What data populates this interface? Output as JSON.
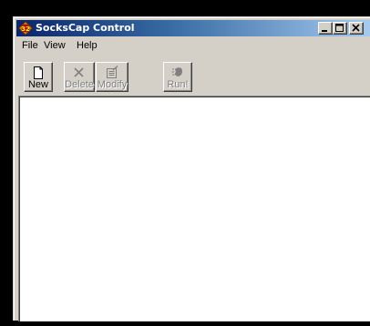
{
  "window": {
    "title": "SocksCap Control",
    "accent_color": "#0a246a"
  },
  "menu": {
    "items": [
      "File",
      "View",
      "Help"
    ]
  },
  "toolbar": {
    "buttons": [
      {
        "label": "New",
        "icon": "new-document-icon",
        "enabled": true
      },
      {
        "label": "Delete",
        "icon": "delete-x-icon",
        "enabled": false
      },
      {
        "label": "Modify",
        "icon": "modify-icon",
        "enabled": false
      },
      {
        "label": "Run!",
        "icon": "run-icon",
        "enabled": false
      }
    ]
  },
  "caption_buttons": [
    "minimize-icon",
    "maximize-icon",
    "close-icon"
  ]
}
